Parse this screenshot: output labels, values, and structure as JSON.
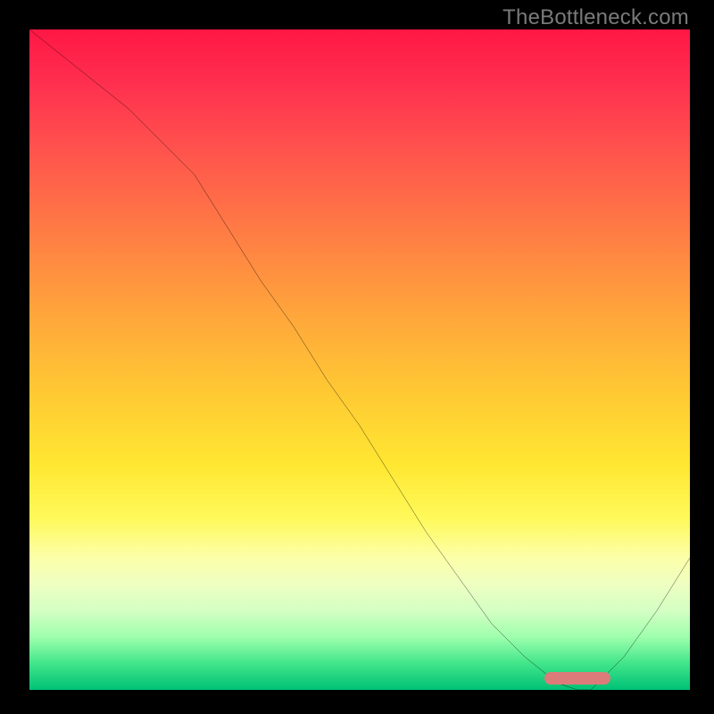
{
  "watermark": "TheBottleneck.com",
  "colors": {
    "frame_bg": "#000000",
    "curve_stroke": "#000000",
    "marker_fill": "#dd7a7a",
    "gradient_stops": [
      "#ff1744",
      "#ff524d",
      "#ffa23c",
      "#ffe732",
      "#fcffa9",
      "#9effad",
      "#00c176"
    ]
  },
  "chart_data": {
    "type": "line",
    "title": "",
    "xlabel": "",
    "ylabel": "",
    "xlim": [
      0,
      100
    ],
    "ylim": [
      0,
      100
    ],
    "x": [
      0,
      5,
      10,
      15,
      20,
      25,
      30,
      35,
      40,
      45,
      50,
      55,
      60,
      65,
      70,
      75,
      80,
      83,
      85,
      90,
      95,
      100
    ],
    "values": [
      100,
      96,
      92,
      88,
      83,
      78,
      70,
      62,
      55,
      47,
      40,
      32,
      24,
      17,
      10,
      5,
      1,
      0,
      0,
      5,
      12,
      20
    ],
    "marker_range_x": [
      78,
      88
    ],
    "annotations": []
  }
}
